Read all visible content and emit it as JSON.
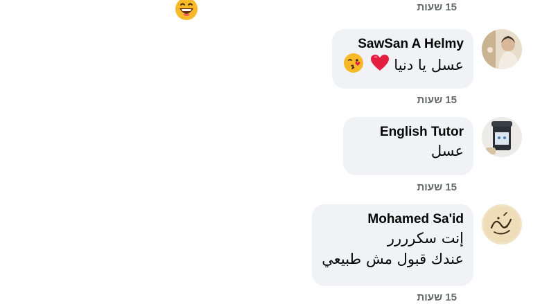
{
  "comments": [
    {
      "time": "15 שעות"
    },
    {
      "author": "SawSan A Helmy",
      "text": "عسل يا دنيا",
      "time": "15 שעות",
      "emojis": [
        "red-heart",
        "face-blowing-kiss"
      ]
    },
    {
      "author": "English Tutor",
      "text": "عسل",
      "time": "15 שעות"
    },
    {
      "author": "Mohamed Sa'id",
      "lines": [
        "إنت سكرررر",
        "عندك قبول مش طبيعي"
      ],
      "time": "15 שעות"
    }
  ],
  "colors": {
    "bubble": "#f0f2f5",
    "text": "#050505",
    "meta": "#65676b",
    "heart": "#e41e3f",
    "emoji_yellow": "#f7b928"
  }
}
